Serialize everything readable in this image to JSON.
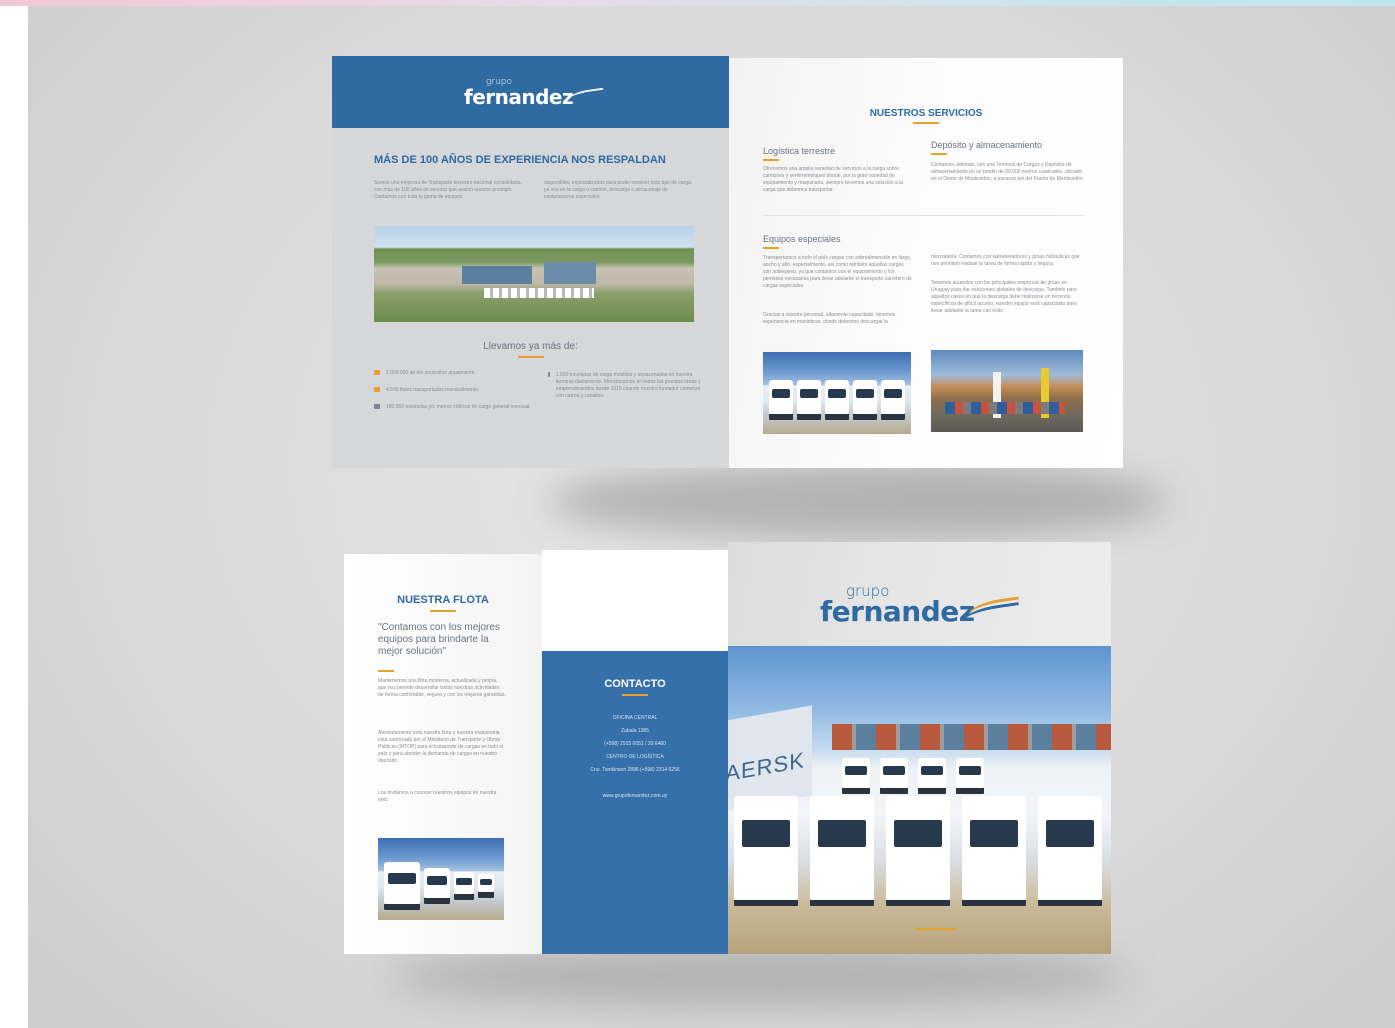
{
  "colors": {
    "brand_blue": "#2f6aa3",
    "accent_orange": "#e5a22f",
    "background": "#d9d9d9"
  },
  "logo": {
    "small_word": "grupo",
    "big_word": "fernandez"
  },
  "inside_left": {
    "headline": "MÁS DE 100 AÑOS DE EXPERIENCIA NOS RESPALDAN",
    "intro_col1": "Somos una empresa de Transporte terrestre nacional consolidada, con más de 100 años de servicio que avalan nuestro prestigio. Contamos con toda la gama de equipos",
    "intro_col2": "disponibles, especializados para poder resolver todo tipo de carga, ya sea en la carga o camión, descarga o almacenaje de contenedores especiales.",
    "subheading": "Llevamos ya más de:",
    "stats_left": [
      "2.000.000 de km recorridos anualmente.",
      "4.500 fletes transportados mensualmente.",
      "180.000 toneladas y/o metros cúbicos de carga general mensual."
    ],
    "stats_right": "1.500 toneladas de carga movidas y almacenadas en nuestra terminal diariamente. Mencionamos en todas las grandes obras y emprendimientos desde 1915 cuando nuestro fundador comenzó con carros y caballos."
  },
  "inside_right": {
    "title": "NUESTROS SERVICIOS",
    "service1_title": "Logística terrestre",
    "service1_text": "Ofrecemos una amplia variedad de servicios a la carga sobre camiones y semirremolques donde, por la gran variedad de equipamiento y maquinaria, siempre tenemos una solución a la carga que debemos transportar.",
    "service2_title": "Depósito y almacenamiento",
    "service2_text": "Contamos, además, con una Terminal de Cargas y Depósito de almacenamiento en un predio de 60.000 metros cuadrados, ubicado en el Oeste de Montevideo, a escasos km del Puerto de Montevideo.",
    "service3_title": "Equipos especiales",
    "service3_text": "Transportamos a todo el país cargas con sobredimensión en largo, ancho y alto, especialmente, así como también aquellas cargas con sobrepeso, ya que contamos con el equipamiento y los permisos necesarios para llevar adelante el transporte carretero de cargas especiales.",
    "service3_text_b": "Gracias a nuestro personal, altamente capacitado, tenemos experiencia en maniobras, donde debemos descargar la",
    "service3_col2a": "mercadería. Contamos con autoelevadores y grúas hidráulicas que nos permiten realizar la tarea de forma rápida y segura.",
    "service3_col2b": "Tenemos acuerdos con las principales empresas de grúas en Uruguay para dar soluciones globales de descarga. También para aquellos casos en que la descarga debe realizarse en terrenos específicos de difícil acceso, nuestro equipo está capacitado para llevar adelante la tarea con éxito."
  },
  "outside_left": {
    "title": "NUESTRA FLOTA",
    "quote": "\"Contamos con los mejores equipos para brindarte la mejor solución\"",
    "para1": "Mantenemos una flota moderna, actualizada y propia, que nos permite desarrollar todas nuestras actividades de forma confortable, segura y con los mejores garantías.",
    "para2": "Absolutamente toda nuestra flota y nuestra maquinaria está autorizada por el Ministerio de Transporte y Obras Públicas (MTOP) para el transporte de cargas en todo el país y para atender la demanda de cargas en nuestro depósito.",
    "para3": "Los invitamos a conocer nuestros equipos en nuestra web."
  },
  "contact": {
    "title": "CONTACTO",
    "line1": "OFICINA CENTRAL",
    "line2": "Zabala 1385",
    "line3": "(+598) 2915 0051 / 29 6460",
    "line4": "CENTRO DE LOGÍSTICA",
    "line5": "Cno. Tomkinson 2896 (+598) 2314 6256",
    "web": "www.grupofernandez.com.uy"
  },
  "cover": {
    "truck_brand": "MAERSK"
  }
}
